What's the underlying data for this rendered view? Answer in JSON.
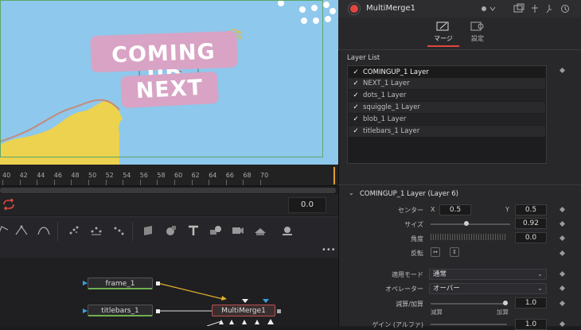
{
  "viewer": {
    "title_line1": "COMING UP",
    "title_line2": "NEXT"
  },
  "timeline": {
    "ticks": [
      "40",
      "42",
      "44",
      "46",
      "48",
      "50",
      "52",
      "54",
      "56",
      "58",
      "60",
      "62",
      "64",
      "66",
      "68",
      "70"
    ],
    "time_value": "0.0"
  },
  "nodes": {
    "menu_label": "•••",
    "items": [
      {
        "label": "frame_1"
      },
      {
        "label": "titlebars_1"
      },
      {
        "label": "MultiMerge1"
      }
    ]
  },
  "inspector": {
    "title": "MultiMerge1",
    "tabs": [
      {
        "label": "マージ"
      },
      {
        "label": "設定"
      }
    ],
    "layer_list_label": "Layer List",
    "layers": [
      {
        "label": "COMINGUP_1 Layer",
        "checked": "✓"
      },
      {
        "label": "NEXT_1 Layer",
        "checked": "✓"
      },
      {
        "label": "dots_1 Layer",
        "checked": "✓"
      },
      {
        "label": "squiggle_1 Layer",
        "checked": "✓"
      },
      {
        "label": "blob_1 Layer",
        "checked": "✓"
      },
      {
        "label": "titlebars_1 Layer",
        "checked": "✓"
      }
    ],
    "section_title": "COMINGUP_1 Layer (Layer 6)",
    "center": {
      "label": "センター",
      "x_label": "X",
      "x_value": "0.5",
      "y_label": "Y",
      "y_value": "0.5"
    },
    "size": {
      "label": "サイズ",
      "value": "0.92"
    },
    "angle": {
      "label": "角度",
      "value": "0.0"
    },
    "flip": {
      "label": "反転"
    },
    "apply_mode": {
      "label": "適用モード",
      "value": "通常"
    },
    "operator": {
      "label": "オペレーター",
      "value": "オーバー"
    },
    "subtractive": {
      "label": "減算/加算",
      "value": "1.0",
      "left": "減算",
      "right": "加算"
    },
    "gain": {
      "label": "ゲイン (アルファ)",
      "value": "1.0"
    }
  },
  "colors": {
    "viewer_bg": "#8ec8ec",
    "title_bar": "#d8a3c4",
    "blob": "#ecd24e",
    "accent_red": "#e0473f"
  }
}
